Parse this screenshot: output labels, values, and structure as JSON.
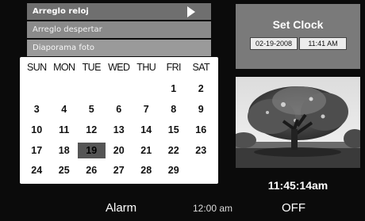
{
  "menu": {
    "items": [
      {
        "label": "Arreglo reloj"
      },
      {
        "label": "Arreglo despertar"
      },
      {
        "label": "Diaporama foto"
      }
    ]
  },
  "calendar": {
    "weekdays": [
      "SUN",
      "MON",
      "TUE",
      "WED",
      "THU",
      "FRI",
      "SAT"
    ],
    "weeks": [
      [
        "",
        "",
        "",
        "",
        "",
        "1",
        "2"
      ],
      [
        "3",
        "4",
        "5",
        "6",
        "7",
        "8",
        "9"
      ],
      [
        "10",
        "11",
        "12",
        "13",
        "14",
        "15",
        "16"
      ],
      [
        "17",
        "18",
        "19",
        "20",
        "21",
        "22",
        "23"
      ],
      [
        "24",
        "25",
        "26",
        "27",
        "28",
        "29",
        ""
      ]
    ],
    "selected_day": "19"
  },
  "clock_panel": {
    "title": "Set Clock",
    "date": "02-19-2008",
    "time": "11:41 AM"
  },
  "current_time": "11:45:14am",
  "alarm": {
    "label": "Alarm",
    "time": "12:00 am",
    "state": "OFF"
  },
  "colors": {
    "background": "#000000",
    "panel_gray": "#7a7a7a",
    "selected_item": "#6f6f6f",
    "today_highlight": "#555555"
  }
}
